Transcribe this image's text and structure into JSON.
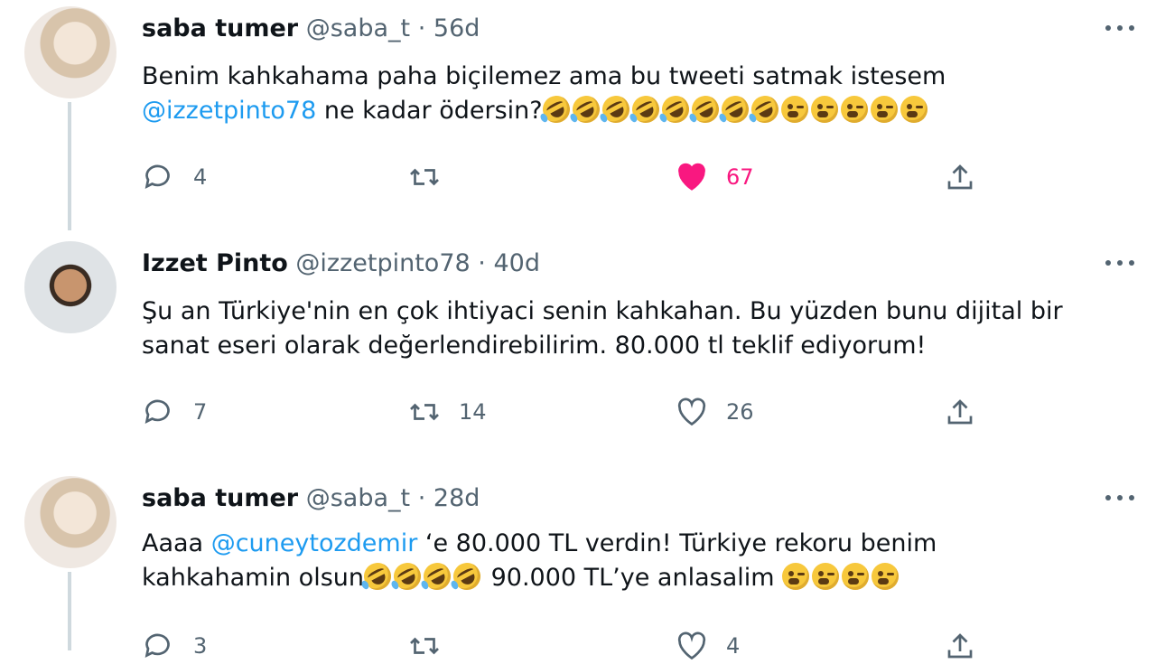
{
  "tweets": [
    {
      "name": "saba tumer",
      "handle": "@saba_t",
      "separator": "·",
      "time": "56d",
      "line1": "Benim kahkahama paha biçilemez ama bu tweeti satmak istesem",
      "mention": "@izzetpinto78",
      "line2_rest": " ne kadar ödersin?",
      "emojis": [
        "rofl",
        "rofl",
        "rofl",
        "rofl",
        "rofl",
        "rofl",
        "rofl",
        "rofl",
        "wink",
        "wink",
        "wink",
        "wink",
        "wink"
      ],
      "replies": "4",
      "retweets": "",
      "likes": "67",
      "liked": true
    },
    {
      "name": "Izzet Pinto",
      "handle": "@izzetpinto78",
      "separator": "·",
      "time": "40d",
      "line1": "Şu an Türkiye'nin en çok ihtiyaci senin kahkahan. Bu yüzden bunu dijital bir",
      "line2": "sanat eseri olarak değerlendirebilirim. 80.000 tl teklif ediyorum!",
      "replies": "7",
      "retweets": "14",
      "likes": "26",
      "liked": false
    },
    {
      "name": "saba tumer",
      "handle": "@saba_t",
      "separator": "·",
      "time": "28d",
      "line1_start": "Aaaa ",
      "mention": "@cuneytozdemir",
      "line1_rest": " ‘e 80.000 TL verdin! Türkiye rekoru benim",
      "line2_start": "kahkahamin olsun",
      "line2_rest": " 90.000 TL’ye anlasalim ",
      "replies": "3",
      "retweets": "",
      "likes": "4",
      "liked": false
    }
  ],
  "icons": {
    "reply": "reply-icon",
    "retweet": "retweet-icon",
    "like": "heart-icon",
    "share": "share-icon",
    "more": "more-options-icon"
  },
  "colors": {
    "mention": "#1d9bf0",
    "like_active": "#f91880",
    "thread_line": "#cfd9de",
    "muted": "#536471"
  }
}
